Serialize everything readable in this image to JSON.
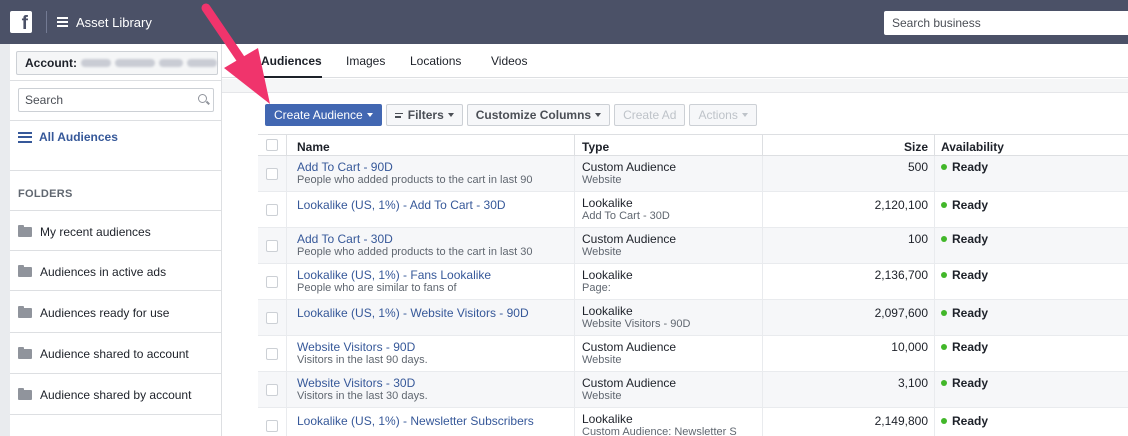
{
  "topbar": {
    "logo": "f",
    "title": "Asset Library",
    "search_placeholder": "Search business"
  },
  "sidebar": {
    "account_label": "Account:",
    "search_placeholder": "Search",
    "all_audiences": "All Audiences",
    "folders_label": "FOLDERS",
    "folders": [
      "My recent audiences",
      "Audiences in active ads",
      "Audiences ready for use",
      "Audience shared to account",
      "Audience shared by account"
    ]
  },
  "tabs": [
    "Audiences",
    "Images",
    "Locations",
    "Videos"
  ],
  "toolbar": {
    "create": "Create Audience",
    "filters": "Filters",
    "customize": "Customize Columns",
    "create_ad": "Create Ad",
    "actions": "Actions"
  },
  "table": {
    "headers": {
      "name": "Name",
      "type": "Type",
      "size": "Size",
      "availability": "Availability"
    },
    "rows": [
      {
        "name": "Add To Cart - 90D",
        "desc": "People who added products to the cart in last 90",
        "type": "Custom Audience",
        "subtype": "Website",
        "size": "500",
        "status": "Ready"
      },
      {
        "name": "Lookalike (US, 1%) - Add To Cart - 30D",
        "desc": "",
        "type": "Lookalike",
        "subtype": "Add To Cart - 30D",
        "size": "2,120,100",
        "status": "Ready"
      },
      {
        "name": "Add To Cart - 30D",
        "desc": "People who added products to the cart in last 30",
        "type": "Custom Audience",
        "subtype": "Website",
        "size": "100",
        "status": "Ready"
      },
      {
        "name": "Lookalike (US, 1%) - Fans Lookalike",
        "desc": "People who are similar to fans of",
        "type": "Lookalike",
        "subtype": "Page:",
        "size": "2,136,700",
        "status": "Ready"
      },
      {
        "name": "Lookalike (US, 1%) - Website Visitors - 90D",
        "desc": "",
        "type": "Lookalike",
        "subtype": "Website Visitors - 90D",
        "size": "2,097,600",
        "status": "Ready"
      },
      {
        "name": "Website Visitors - 90D",
        "desc": "Visitors in the last 90 days.",
        "type": "Custom Audience",
        "subtype": "Website",
        "size": "10,000",
        "status": "Ready"
      },
      {
        "name": "Website Visitors - 30D",
        "desc": "Visitors in the last 30 days.",
        "type": "Custom Audience",
        "subtype": "Website",
        "size": "3,100",
        "status": "Ready"
      },
      {
        "name": "Lookalike (US, 1%) - Newsletter Subscribers",
        "desc": "",
        "type": "Lookalike",
        "subtype": "Custom Audience: Newsletter S",
        "size": "2,149,800",
        "status": "Ready"
      }
    ]
  },
  "colors": {
    "topbar": "#4b5167",
    "primary": "#4267b2",
    "link": "#365899",
    "ready": "#42b72a",
    "arrow": "#f0346c"
  }
}
